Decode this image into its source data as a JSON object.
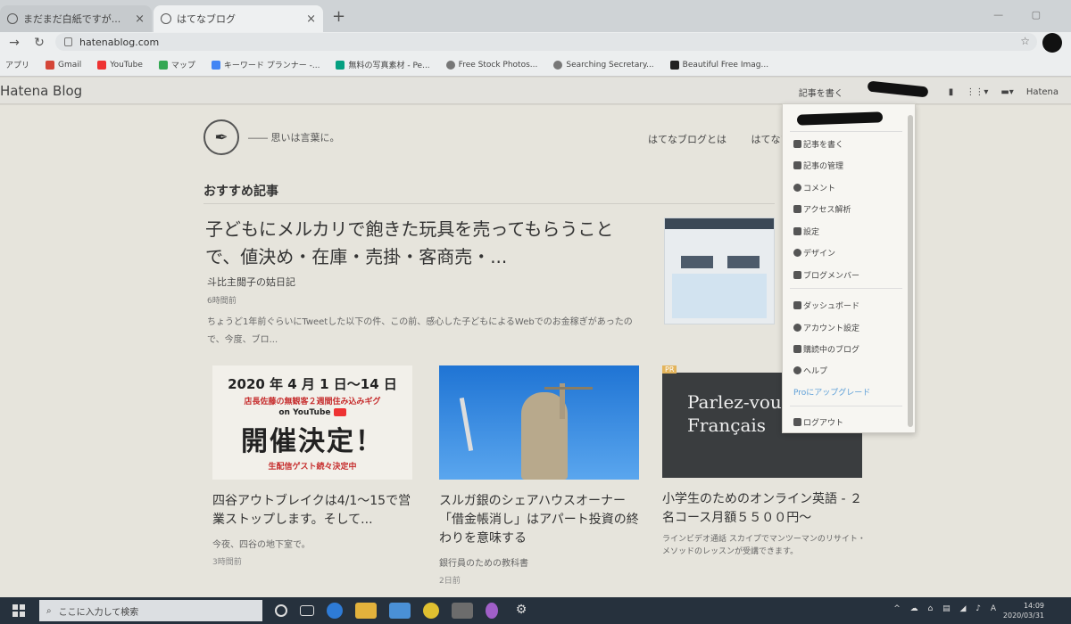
{
  "browser": {
    "tabs": [
      {
        "title": "まだまだ白紙ですが...",
        "active": false
      },
      {
        "title": "はてなブログ",
        "active": true
      }
    ],
    "new_tab_glyph": "+",
    "url": "hatenablog.com",
    "bookmarks": [
      {
        "label": "アプリ",
        "icon": "apps-grid-icon",
        "color": "#4a7bd4"
      },
      {
        "label": "Gmail",
        "icon": "gmail-icon",
        "color": "#d44638"
      },
      {
        "label": "YouTube",
        "icon": "youtube-icon",
        "color": "#e33"
      },
      {
        "label": "マップ",
        "icon": "maps-icon",
        "color": "#34a853"
      },
      {
        "label": "キーワード プランナー -...",
        "icon": "google-ads-icon",
        "color": "#4285f4"
      },
      {
        "label": "無料の写真素材 - Pe...",
        "icon": "pexels-icon",
        "color": "#05a081"
      },
      {
        "label": "Free Stock Photos...",
        "icon": "globe-icon",
        "color": "#777"
      },
      {
        "label": "Searching Secretary...",
        "icon": "globe-icon",
        "color": "#777"
      },
      {
        "label": "Beautiful Free Imag...",
        "icon": "camera-icon",
        "color": "#222"
      }
    ]
  },
  "hatena_header": {
    "logo": "Hatena Blog",
    "write_label": "記事を書く",
    "right_label": "Hatena"
  },
  "blog": {
    "tagline": "―― 思いは言葉に。",
    "nav": [
      "はてなブログとは",
      "はてなブロ"
    ],
    "section_title": "おすすめ記事",
    "featured": {
      "title": "子どもにメルカリで飽きた玩具を売ってもらうことで、値決め・在庫・売掛・客商売・...",
      "source": "斗比主閲子の姑日記",
      "time": "6時間前",
      "excerpt": "ちょうど1年前ぐらいにTweetした以下の件、この前、感心した子どもによるWebでのお金稼ぎがあったので、今度、ブロ..."
    },
    "cards": [
      {
        "title": "四谷アウトブレイクは4/1〜15で営業ストップします。そして...",
        "source": "今夜、四谷の地下室で。",
        "time": "3時間前",
        "poster": {
          "line1": "2020 年 4 月 1 日〜14 日",
          "line2": "店長佐藤の無観客２週間住み込みギグ",
          "line3": "on YouTube",
          "line4": "開催決定！",
          "line5": "生配信ゲスト続々決定中"
        }
      },
      {
        "title": "スルガ銀のシェアハウスオーナー「借金帳消し」はアパート投資の終わりを意味する",
        "source": "銀行員のための教科書",
        "time": "2日前"
      },
      {
        "title": "小学生のためのオンライン英語 - ２名コース月額５５００円〜",
        "excerpt": "ラインビデオ通話 スカイプでマンツーマンのリサイト・メソッドのレッスンが受講できます。",
        "badge": "PR",
        "chalk_line1": "Parlez-vou",
        "chalk_line2": "Français"
      }
    ]
  },
  "dropdown": {
    "items": [
      {
        "label": "記事を書く",
        "icon": "edit-icon"
      },
      {
        "label": "記事の管理",
        "icon": "list-icon"
      },
      {
        "label": "コメント",
        "icon": "comment-icon"
      },
      {
        "label": "アクセス解析",
        "icon": "chart-icon"
      },
      {
        "label": "設定",
        "icon": "wrench-icon"
      },
      {
        "label": "デザイン",
        "icon": "palette-icon"
      },
      {
        "label": "ブログメンバー",
        "icon": "members-icon"
      },
      {
        "label": "ダッシュボード",
        "icon": "home-icon"
      },
      {
        "label": "アカウント設定",
        "icon": "account-icon"
      },
      {
        "label": "購読中のブログ",
        "icon": "bookmark-icon"
      },
      {
        "label": "ヘルプ",
        "icon": "help-icon"
      },
      {
        "label": "Proにアップグレード",
        "icon": ""
      },
      {
        "label": "ログアウト",
        "icon": "logout-icon"
      }
    ]
  },
  "taskbar": {
    "search_placeholder": "ここに入力して検索",
    "time": "14:09",
    "date": "2020/03/31",
    "accent": "#26313d"
  }
}
